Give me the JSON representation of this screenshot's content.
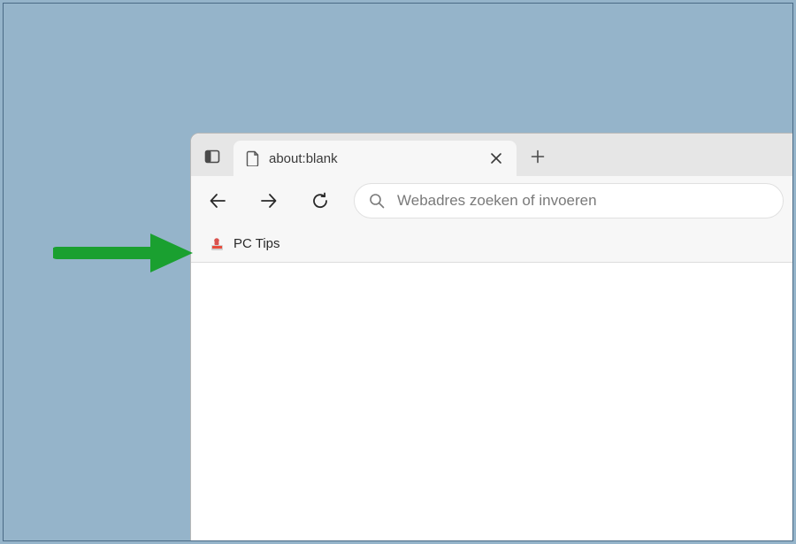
{
  "tab": {
    "title": "about:blank"
  },
  "addressBar": {
    "placeholder": "Webadres zoeken of invoeren"
  },
  "bookmarks": {
    "items": [
      {
        "label": "PC Tips"
      }
    ]
  },
  "colors": {
    "desktop": "#95b4ca",
    "arrow": "#1aa030",
    "tabBg": "#f7f7f7",
    "stripBg": "#e6e6e6"
  }
}
